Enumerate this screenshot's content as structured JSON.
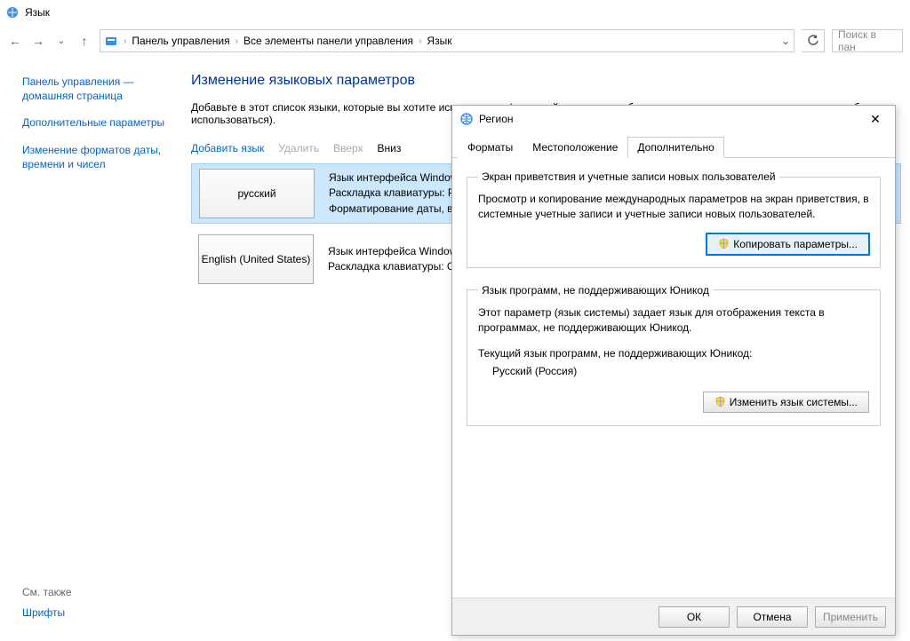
{
  "titlebar": {
    "text": "Язык"
  },
  "nav": {
    "crumbs": [
      "Панель управления",
      "Все элементы панели управления",
      "Язык"
    ],
    "search_placeholder": "Поиск в пан"
  },
  "sidebar": {
    "home": "Панель управления — домашняя страница",
    "links": [
      "Дополнительные параметры",
      "Изменение форматов даты, времени и чисел"
    ],
    "see_also": "См. также",
    "bottom_link": "Шрифты"
  },
  "main": {
    "title": "Изменение языковых параметров",
    "desc": "Добавьте в этот список языки, которые вы хотите использовать (основной язык должен быть первым в списке, так как он чаще всего будет использоваться).",
    "commands": {
      "add": "Добавить язык",
      "remove": "Удалить",
      "up": "Вверх",
      "down": "Вниз"
    },
    "languages": [
      {
        "name": "русский",
        "detail": "Язык интерфейса Windows: Включен\nРаскладка клавиатуры: Русская\nФорматирование даты, времени и чисел"
      },
      {
        "name": "English (United States)",
        "detail": "Язык интерфейса Windows: Доступен\nРаскладка клавиатуры: США"
      }
    ]
  },
  "dialog": {
    "title": "Регион",
    "close": "✕",
    "tabs": [
      "Форматы",
      "Местоположение",
      "Дополнительно"
    ],
    "group1": {
      "legend": "Экран приветствия и учетные записи новых пользователей",
      "text": "Просмотр и копирование международных параметров на экран приветствия, в системные учетные записи и учетные записи новых пользователей.",
      "button": "Копировать параметры..."
    },
    "group2": {
      "legend": "Язык программ, не поддерживающих Юникод",
      "text": "Этот параметр (язык системы) задает язык для отображения текста в программах, не поддерживающих Юникод.",
      "current_label": "Текущий язык программ, не поддерживающих Юникод:",
      "current_value": "Русский (Россия)",
      "button": "Изменить язык системы..."
    },
    "footer": {
      "ok": "ОК",
      "cancel": "Отмена",
      "apply": "Применить"
    }
  }
}
